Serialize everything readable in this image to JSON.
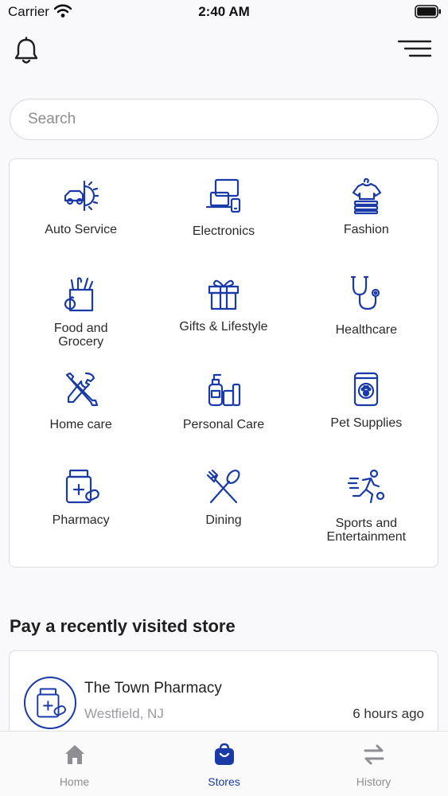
{
  "status_bar": {
    "carrier": "Carrier",
    "time": "2:40 AM"
  },
  "header": {
    "left_icon": "bell-icon",
    "right_icon": "menu-icon"
  },
  "search": {
    "placeholder": "Search",
    "value": ""
  },
  "categories": [
    {
      "label": "Auto Service",
      "icon": "car-gear-icon"
    },
    {
      "label": "Electronics",
      "icon": "devices-icon"
    },
    {
      "label": "Fashion",
      "icon": "clothes-icon"
    },
    {
      "label": "Food and Grocery",
      "icon": "grocery-bag-icon"
    },
    {
      "label": "Gifts & Lifestyle",
      "icon": "gift-icon"
    },
    {
      "label": "Healthcare",
      "icon": "stethoscope-icon"
    },
    {
      "label": "Home care",
      "icon": "tools-icon"
    },
    {
      "label": "Personal Care",
      "icon": "toiletries-icon"
    },
    {
      "label": "Pet Supplies",
      "icon": "pet-food-icon"
    },
    {
      "label": "Pharmacy",
      "icon": "pill-bottle-icon"
    },
    {
      "label": "Dining",
      "icon": "fork-spoon-icon"
    },
    {
      "label": "Sports and Entertainment",
      "icon": "runner-icon"
    }
  ],
  "recent": {
    "title": "Pay a recently visited store",
    "store": {
      "name": "The Town Pharmacy",
      "location": "Westfield, NJ",
      "time": "6 hours ago",
      "icon": "pill-bottle-icon"
    }
  },
  "tabs": [
    {
      "label": "Home",
      "icon": "home-icon",
      "active": false
    },
    {
      "label": "Stores",
      "icon": "shopping-bag-icon",
      "active": true
    },
    {
      "label": "History",
      "icon": "swap-arrows-icon",
      "active": false
    }
  ],
  "colors": {
    "accent": "#1a3aa8",
    "inactive": "#8e8e93",
    "background": "#f9f9fb"
  }
}
